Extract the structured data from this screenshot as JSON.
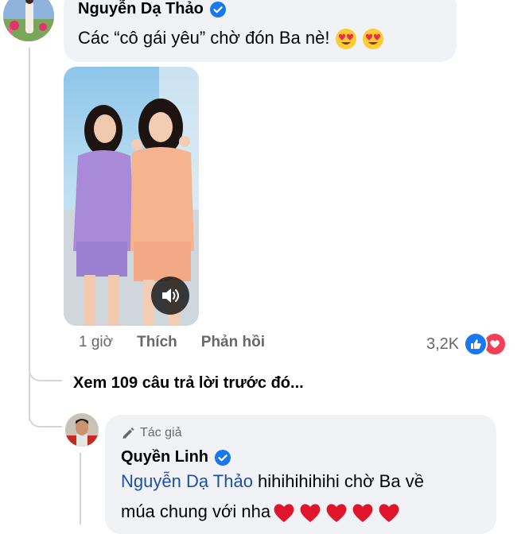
{
  "comment": {
    "author": "Nguyễn Dạ Thảo",
    "text": "Các “cô gái yêu” chờ đón Ba nè!",
    "emoji": "heart-eyes",
    "time": "1 giờ",
    "like_label": "Thích",
    "reply_label": "Phản hồi",
    "reaction_count": "3,2K"
  },
  "view_more": "Xem 109 câu trả lời trước đó...",
  "reply": {
    "author_tag": "Tác giả",
    "author": "Quyền Linh",
    "mention": "Nguyễn Dạ Thảo",
    "text_after_mention": " hihihihihihi chờ Ba về",
    "text_line2": "múa chung với nha",
    "heart_count": 5
  },
  "colors": {
    "bubble": "#f0f2f5",
    "verified": "#1877f2",
    "mention": "#1d4fa8",
    "like_reaction": "#1877f2",
    "love_reaction": "#f33e58"
  }
}
